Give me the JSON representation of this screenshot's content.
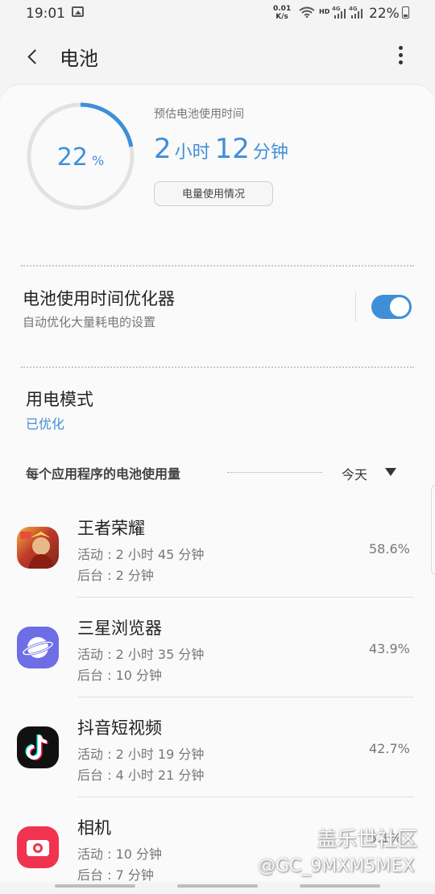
{
  "status_bar": {
    "time": "19:01",
    "net_speed_value": "0.01",
    "net_speed_unit": "K/s",
    "hd": "HD",
    "signal_1": "4G",
    "signal_2": "4G",
    "battery_percent": "22%"
  },
  "header": {
    "title": "电池"
  },
  "battery": {
    "percent_number": "22",
    "percent_unit": "%",
    "level_fraction": 0.22,
    "estimate_label": "预估电池使用时间",
    "estimate_hours": "2",
    "estimate_hours_unit": "小时",
    "estimate_minutes": "12",
    "estimate_minutes_unit": "分钟",
    "usage_button": "电量使用情况",
    "accent_color": "#3f8fd8"
  },
  "optimizer": {
    "title": "电池使用时间优化器",
    "subtitle": "自动优化大量耗电的设置",
    "enabled": true
  },
  "power_mode": {
    "title": "用电模式",
    "value": "已优化"
  },
  "app_usage": {
    "section_label": "每个应用程序的电池使用量",
    "period": "今天",
    "apps": [
      {
        "name": "王者荣耀",
        "active": "活动 : 2 小时 45 分钟",
        "background": "后台 : 2 分钟",
        "percent": "58.6%",
        "icon": "game-icon"
      },
      {
        "name": "三星浏览器",
        "active": "活动 : 2 小时 35 分钟",
        "background": "后台 : 10 分钟",
        "percent": "43.9%",
        "icon": "browser-icon"
      },
      {
        "name": "抖音短视频",
        "active": "活动 : 2 小时 19 分钟",
        "background": "后台 : 4 小时 21 分钟",
        "percent": "42.7%",
        "icon": "tiktok-icon"
      },
      {
        "name": "相机",
        "active": "活动 : 10 分钟",
        "background": "后台 : 7 分钟",
        "percent": "5.1%",
        "icon": "camera-icon"
      }
    ]
  },
  "watermark": {
    "line1": "盖乐世社区",
    "line2": "@GC_9MXM5MEX"
  }
}
